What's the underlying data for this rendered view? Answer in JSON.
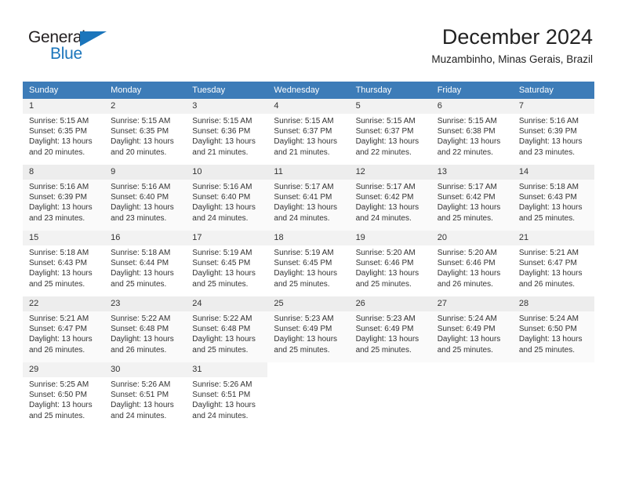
{
  "brand": {
    "name_part1": "General",
    "name_part2": "Blue",
    "accent_color": "#1b75bb"
  },
  "header": {
    "title": "December 2024",
    "subtitle": "Muzambinho, Minas Gerais, Brazil"
  },
  "theme": {
    "header_row_bg": "#3d7cb8",
    "header_row_text": "#ffffff",
    "daynum_bg": "#f2f2f2",
    "text_color": "#333333"
  },
  "labels": {
    "sunrise_prefix": "Sunrise:",
    "sunset_prefix": "Sunset:",
    "daylight_prefix": "Daylight:"
  },
  "weekdays": [
    "Sunday",
    "Monday",
    "Tuesday",
    "Wednesday",
    "Thursday",
    "Friday",
    "Saturday"
  ],
  "weeks": [
    [
      {
        "day": "1",
        "sunrise": "Sunrise: 5:15 AM",
        "sunset": "Sunset: 6:35 PM",
        "daylight_1": "Daylight: 13 hours",
        "daylight_2": "and 20 minutes."
      },
      {
        "day": "2",
        "sunrise": "Sunrise: 5:15 AM",
        "sunset": "Sunset: 6:35 PM",
        "daylight_1": "Daylight: 13 hours",
        "daylight_2": "and 20 minutes."
      },
      {
        "day": "3",
        "sunrise": "Sunrise: 5:15 AM",
        "sunset": "Sunset: 6:36 PM",
        "daylight_1": "Daylight: 13 hours",
        "daylight_2": "and 21 minutes."
      },
      {
        "day": "4",
        "sunrise": "Sunrise: 5:15 AM",
        "sunset": "Sunset: 6:37 PM",
        "daylight_1": "Daylight: 13 hours",
        "daylight_2": "and 21 minutes."
      },
      {
        "day": "5",
        "sunrise": "Sunrise: 5:15 AM",
        "sunset": "Sunset: 6:37 PM",
        "daylight_1": "Daylight: 13 hours",
        "daylight_2": "and 22 minutes."
      },
      {
        "day": "6",
        "sunrise": "Sunrise: 5:15 AM",
        "sunset": "Sunset: 6:38 PM",
        "daylight_1": "Daylight: 13 hours",
        "daylight_2": "and 22 minutes."
      },
      {
        "day": "7",
        "sunrise": "Sunrise: 5:16 AM",
        "sunset": "Sunset: 6:39 PM",
        "daylight_1": "Daylight: 13 hours",
        "daylight_2": "and 23 minutes."
      }
    ],
    [
      {
        "day": "8",
        "sunrise": "Sunrise: 5:16 AM",
        "sunset": "Sunset: 6:39 PM",
        "daylight_1": "Daylight: 13 hours",
        "daylight_2": "and 23 minutes."
      },
      {
        "day": "9",
        "sunrise": "Sunrise: 5:16 AM",
        "sunset": "Sunset: 6:40 PM",
        "daylight_1": "Daylight: 13 hours",
        "daylight_2": "and 23 minutes."
      },
      {
        "day": "10",
        "sunrise": "Sunrise: 5:16 AM",
        "sunset": "Sunset: 6:40 PM",
        "daylight_1": "Daylight: 13 hours",
        "daylight_2": "and 24 minutes."
      },
      {
        "day": "11",
        "sunrise": "Sunrise: 5:17 AM",
        "sunset": "Sunset: 6:41 PM",
        "daylight_1": "Daylight: 13 hours",
        "daylight_2": "and 24 minutes."
      },
      {
        "day": "12",
        "sunrise": "Sunrise: 5:17 AM",
        "sunset": "Sunset: 6:42 PM",
        "daylight_1": "Daylight: 13 hours",
        "daylight_2": "and 24 minutes."
      },
      {
        "day": "13",
        "sunrise": "Sunrise: 5:17 AM",
        "sunset": "Sunset: 6:42 PM",
        "daylight_1": "Daylight: 13 hours",
        "daylight_2": "and 25 minutes."
      },
      {
        "day": "14",
        "sunrise": "Sunrise: 5:18 AM",
        "sunset": "Sunset: 6:43 PM",
        "daylight_1": "Daylight: 13 hours",
        "daylight_2": "and 25 minutes."
      }
    ],
    [
      {
        "day": "15",
        "sunrise": "Sunrise: 5:18 AM",
        "sunset": "Sunset: 6:43 PM",
        "daylight_1": "Daylight: 13 hours",
        "daylight_2": "and 25 minutes."
      },
      {
        "day": "16",
        "sunrise": "Sunrise: 5:18 AM",
        "sunset": "Sunset: 6:44 PM",
        "daylight_1": "Daylight: 13 hours",
        "daylight_2": "and 25 minutes."
      },
      {
        "day": "17",
        "sunrise": "Sunrise: 5:19 AM",
        "sunset": "Sunset: 6:45 PM",
        "daylight_1": "Daylight: 13 hours",
        "daylight_2": "and 25 minutes."
      },
      {
        "day": "18",
        "sunrise": "Sunrise: 5:19 AM",
        "sunset": "Sunset: 6:45 PM",
        "daylight_1": "Daylight: 13 hours",
        "daylight_2": "and 25 minutes."
      },
      {
        "day": "19",
        "sunrise": "Sunrise: 5:20 AM",
        "sunset": "Sunset: 6:46 PM",
        "daylight_1": "Daylight: 13 hours",
        "daylight_2": "and 25 minutes."
      },
      {
        "day": "20",
        "sunrise": "Sunrise: 5:20 AM",
        "sunset": "Sunset: 6:46 PM",
        "daylight_1": "Daylight: 13 hours",
        "daylight_2": "and 26 minutes."
      },
      {
        "day": "21",
        "sunrise": "Sunrise: 5:21 AM",
        "sunset": "Sunset: 6:47 PM",
        "daylight_1": "Daylight: 13 hours",
        "daylight_2": "and 26 minutes."
      }
    ],
    [
      {
        "day": "22",
        "sunrise": "Sunrise: 5:21 AM",
        "sunset": "Sunset: 6:47 PM",
        "daylight_1": "Daylight: 13 hours",
        "daylight_2": "and 26 minutes."
      },
      {
        "day": "23",
        "sunrise": "Sunrise: 5:22 AM",
        "sunset": "Sunset: 6:48 PM",
        "daylight_1": "Daylight: 13 hours",
        "daylight_2": "and 26 minutes."
      },
      {
        "day": "24",
        "sunrise": "Sunrise: 5:22 AM",
        "sunset": "Sunset: 6:48 PM",
        "daylight_1": "Daylight: 13 hours",
        "daylight_2": "and 25 minutes."
      },
      {
        "day": "25",
        "sunrise": "Sunrise: 5:23 AM",
        "sunset": "Sunset: 6:49 PM",
        "daylight_1": "Daylight: 13 hours",
        "daylight_2": "and 25 minutes."
      },
      {
        "day": "26",
        "sunrise": "Sunrise: 5:23 AM",
        "sunset": "Sunset: 6:49 PM",
        "daylight_1": "Daylight: 13 hours",
        "daylight_2": "and 25 minutes."
      },
      {
        "day": "27",
        "sunrise": "Sunrise: 5:24 AM",
        "sunset": "Sunset: 6:49 PM",
        "daylight_1": "Daylight: 13 hours",
        "daylight_2": "and 25 minutes."
      },
      {
        "day": "28",
        "sunrise": "Sunrise: 5:24 AM",
        "sunset": "Sunset: 6:50 PM",
        "daylight_1": "Daylight: 13 hours",
        "daylight_2": "and 25 minutes."
      }
    ],
    [
      {
        "day": "29",
        "sunrise": "Sunrise: 5:25 AM",
        "sunset": "Sunset: 6:50 PM",
        "daylight_1": "Daylight: 13 hours",
        "daylight_2": "and 25 minutes."
      },
      {
        "day": "30",
        "sunrise": "Sunrise: 5:26 AM",
        "sunset": "Sunset: 6:51 PM",
        "daylight_1": "Daylight: 13 hours",
        "daylight_2": "and 24 minutes."
      },
      {
        "day": "31",
        "sunrise": "Sunrise: 5:26 AM",
        "sunset": "Sunset: 6:51 PM",
        "daylight_1": "Daylight: 13 hours",
        "daylight_2": "and 24 minutes."
      },
      {
        "day": "",
        "sunrise": "",
        "sunset": "",
        "daylight_1": "",
        "daylight_2": ""
      },
      {
        "day": "",
        "sunrise": "",
        "sunset": "",
        "daylight_1": "",
        "daylight_2": ""
      },
      {
        "day": "",
        "sunrise": "",
        "sunset": "",
        "daylight_1": "",
        "daylight_2": ""
      },
      {
        "day": "",
        "sunrise": "",
        "sunset": "",
        "daylight_1": "",
        "daylight_2": ""
      }
    ]
  ]
}
